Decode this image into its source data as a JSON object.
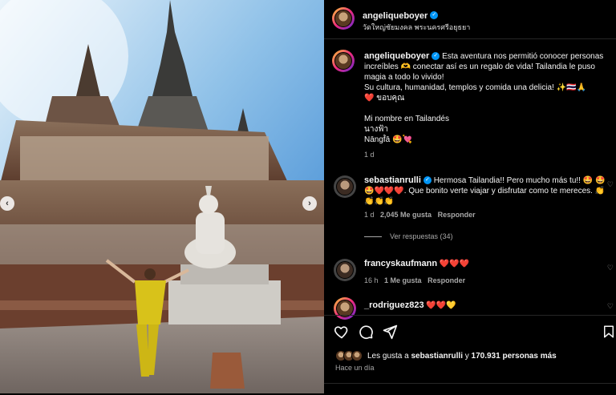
{
  "header": {
    "username": "angeliqueboyer",
    "location": "วัดใหญ่ชัยมงคล พระนครศรีอยุธยา",
    "more_label": "•••"
  },
  "caption": {
    "username": "angeliqueboyer",
    "line1": "Esta aventura nos permitió conocer personas increíbles 🫶 conectar así es un regalo de vida! Tailandia le puso magia a todo lo vivido!",
    "line2": "Su cultura, humanidad, templos y comida una delicia! ✨🇹🇭🙏",
    "line3": "❤️ ขอบคุณ",
    "line4": "Mi nombre en Tailandés",
    "line5": "นางฟ้า",
    "line6": "Nāngf̂ā 🤩💘",
    "age": "1 d"
  },
  "comments": [
    {
      "username": "sebastianrulli",
      "verified": true,
      "text": "Hermosa Tailandia!! Pero mucho más tu!! 🤩 🤩🤩❤️❤️❤️. Que bonito verte viajar y disfrutar como te mereces. 👏👏👏👏",
      "age": "1 d",
      "likes": "2,045 Me gusta",
      "reply": "Responder",
      "view_replies": "Ver respuestas (34)"
    },
    {
      "username": "francyskaufmann",
      "verified": false,
      "text": "❤️❤️❤️",
      "age": "16 h",
      "likes": "1 Me gusta",
      "reply": "Responder"
    },
    {
      "username": "_rodriguez823",
      "verified": false,
      "text": "❤️❤️💛"
    }
  ],
  "footer": {
    "liked_prefix": "Les gusta a",
    "liked_user": "sebastianrulli",
    "liked_mid": "y",
    "liked_count": "170.931 personas más",
    "time": "Hace un día"
  },
  "icons": [
    "heart-icon",
    "comment-icon",
    "share-icon",
    "bookmark-icon",
    "chevron-left-icon",
    "chevron-right-icon",
    "verified-icon"
  ],
  "colors": {
    "background": "#000000",
    "verified": "#0095f6",
    "muted": "#a8a8a8",
    "text": "#f5f5f5"
  }
}
